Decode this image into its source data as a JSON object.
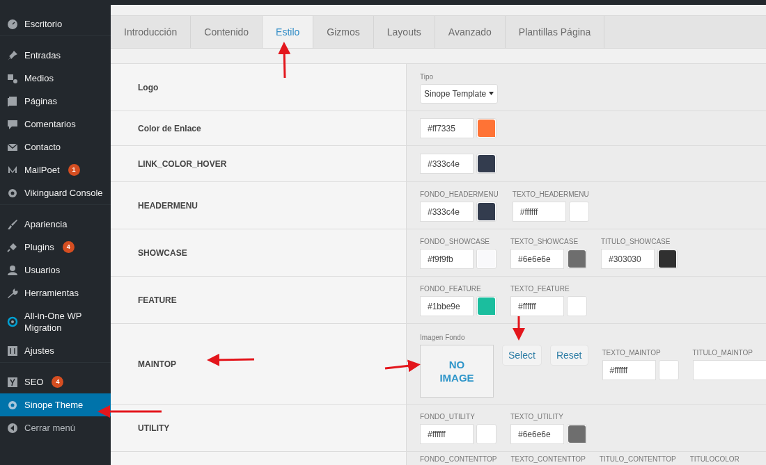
{
  "sidebar": {
    "items": [
      {
        "label": "Escritorio",
        "selected": false,
        "separator_before": false
      },
      {
        "label": "Entradas",
        "selected": false,
        "separator_before": true
      },
      {
        "label": "Medios",
        "selected": false,
        "separator_before": false
      },
      {
        "label": "Páginas",
        "selected": false,
        "separator_before": false
      },
      {
        "label": "Comentarios",
        "selected": false,
        "separator_before": false
      },
      {
        "label": "Contacto",
        "selected": false,
        "separator_before": false
      },
      {
        "label": "MailPoet",
        "badge": "1",
        "selected": false,
        "separator_before": false
      },
      {
        "label": "Vikinguard Console",
        "selected": false,
        "separator_before": false
      },
      {
        "label": "Apariencia",
        "selected": false,
        "separator_before": true
      },
      {
        "label": "Plugins",
        "badge": "4",
        "selected": false,
        "separator_before": false
      },
      {
        "label": "Usuarios",
        "selected": false,
        "separator_before": false
      },
      {
        "label": "Herramientas",
        "selected": false,
        "separator_before": false
      },
      {
        "label": "All-in-One WP Migration",
        "selected": false,
        "separator_before": false
      },
      {
        "label": "Ajustes",
        "selected": false,
        "separator_before": false
      },
      {
        "label": "SEO",
        "badge": "4",
        "selected": false,
        "separator_before": true
      },
      {
        "label": "Sinope Theme",
        "selected": true,
        "separator_before": false
      },
      {
        "label": "Cerrar menú",
        "kind": "collapse",
        "selected": false,
        "separator_before": false
      }
    ]
  },
  "tabs": [
    {
      "label": "Introducción",
      "selected": false
    },
    {
      "label": "Contenido",
      "selected": false
    },
    {
      "label": "Estilo",
      "selected": true
    },
    {
      "label": "Gizmos",
      "selected": false
    },
    {
      "label": "Layouts",
      "selected": false
    },
    {
      "label": "Avanzado",
      "selected": false
    },
    {
      "label": "Plantillas Página",
      "selected": false
    }
  ],
  "settings": [
    {
      "name": "Logo",
      "fields": [
        {
          "kind": "select",
          "label": "Tipo",
          "value": "Sinope Template"
        }
      ]
    },
    {
      "name": "Color de Enlace",
      "fields": [
        {
          "kind": "color",
          "value": "#ff7335",
          "color": "#ff7335"
        }
      ]
    },
    {
      "name": "LINK_COLOR_HOVER",
      "fields": [
        {
          "kind": "color",
          "value": "#333c4e",
          "color": "#333c4e"
        }
      ]
    },
    {
      "name": "HEADERMENU",
      "fields": [
        {
          "kind": "color",
          "label": "FONDO_HEADERMENU",
          "value": "#333c4e",
          "color": "#333c4e"
        },
        {
          "kind": "color",
          "label": "TEXTO_HEADERMENU",
          "value": "#ffffff",
          "color": "#ffffff"
        }
      ]
    },
    {
      "name": "SHOWCASE",
      "fields": [
        {
          "kind": "color",
          "label": "FONDO_SHOWCASE",
          "value": "#f9f9fb",
          "color": "#f9f9fb"
        },
        {
          "kind": "color",
          "label": "TEXTO_SHOWCASE",
          "value": "#6e6e6e",
          "color": "#6e6e6e"
        },
        {
          "kind": "color",
          "label": "TITULO_SHOWCASE",
          "value": "#303030",
          "color": "#303030"
        }
      ]
    },
    {
      "name": "FEATURE",
      "fields": [
        {
          "kind": "color",
          "label": "FONDO_FEATURE",
          "value": "#1bbe9e",
          "color": "#1bbe9e"
        },
        {
          "kind": "color",
          "label": "TEXTO_FEATURE",
          "value": "#ffffff",
          "color": "#ffffff"
        }
      ]
    },
    {
      "name": "MAINTOP",
      "fields": [
        {
          "kind": "image",
          "label": "Imagen Fondo",
          "placeholder_text": "NO IMAGE",
          "buttons": [
            "Select",
            "Reset"
          ]
        },
        {
          "kind": "color",
          "label": "TEXTO_MAINTOP",
          "value": "#ffffff",
          "color": "#ffffff"
        },
        {
          "kind": "text",
          "label": "TITULO_MAINTOP"
        }
      ]
    },
    {
      "name": "UTILITY",
      "fields": [
        {
          "kind": "color",
          "label": "FONDO_UTILITY",
          "value": "#ffffff",
          "color": "#ffffff"
        },
        {
          "kind": "color",
          "label": "TEXTO_UTILITY",
          "value": "#6e6e6e",
          "color": "#6e6e6e"
        }
      ]
    },
    {
      "fields": [
        {
          "kind": "label",
          "label": "FONDO_CONTENTTOP"
        },
        {
          "kind": "label",
          "label": "TEXTO_CONTENTTOP"
        },
        {
          "kind": "label",
          "label": "TITULO_CONTENTTOP"
        },
        {
          "kind": "label",
          "label": "TITULOCOLOR"
        }
      ]
    }
  ]
}
